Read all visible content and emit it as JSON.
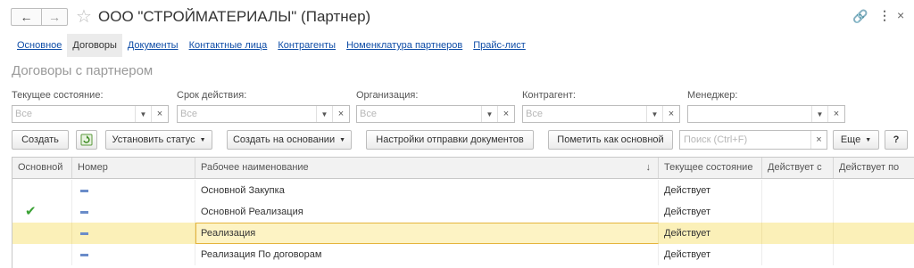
{
  "window": {
    "title": "ООО \"СТРОЙМАТЕРИАЛЫ\" (Партнер)"
  },
  "tabs": [
    {
      "label": "Основное"
    },
    {
      "label": "Договоры"
    },
    {
      "label": "Документы"
    },
    {
      "label": "Контактные лица"
    },
    {
      "label": "Контрагенты"
    },
    {
      "label": "Номенклатура партнеров"
    },
    {
      "label": "Прайс-лист"
    }
  ],
  "section_title": "Договоры с партнером",
  "filters": [
    {
      "label": "Текущее состояние:",
      "placeholder": "Все"
    },
    {
      "label": "Срок действия:",
      "placeholder": "Все"
    },
    {
      "label": "Организация:",
      "placeholder": "Все"
    },
    {
      "label": "Контрагент:",
      "placeholder": "Все"
    },
    {
      "label": "Менеджер:",
      "placeholder": ""
    }
  ],
  "toolbar": {
    "create": "Создать",
    "set_status": "Установить статус",
    "create_based_on": "Создать на основании",
    "send_settings": "Настройки отправки документов",
    "mark_main": "Пометить как основной",
    "search_placeholder": "Поиск (Ctrl+F)",
    "more": "Еще",
    "help": "?"
  },
  "table": {
    "columns": [
      "Основной",
      "Номер",
      "Рабочее наименование",
      "Текущее состояние",
      "Действует с",
      "Действует по"
    ],
    "sort_indicator": "↓",
    "rows": [
      {
        "main": false,
        "name": "Основной Закупка",
        "state": "Действует",
        "selected": false
      },
      {
        "main": true,
        "name": "Основной Реализация",
        "state": "Действует",
        "selected": false
      },
      {
        "main": false,
        "name": "Реализация",
        "state": "Действует",
        "selected": true
      },
      {
        "main": false,
        "name": "Реализация По договорам",
        "state": "Действует",
        "selected": false
      }
    ]
  },
  "colors": {
    "link": "#0f4da7",
    "selected_row": "#fbf0b8",
    "check": "#3ba235"
  }
}
